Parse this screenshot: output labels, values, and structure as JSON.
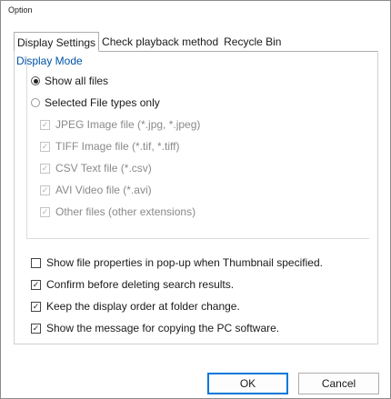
{
  "window": {
    "title": "Option"
  },
  "tabs": [
    {
      "label": "Display Settings",
      "active": true
    },
    {
      "label": "Check playback method",
      "active": false
    },
    {
      "label": "Recycle Bin",
      "active": false
    }
  ],
  "display_mode": {
    "group_label": "Display Mode",
    "show_all_files": {
      "label": "Show all files",
      "selected": true
    },
    "selected_types": {
      "label": "Selected File types only",
      "selected": false
    },
    "file_types": [
      {
        "label": "JPEG Image file (*.jpg, *.jpeg)",
        "checked": true
      },
      {
        "label": "TIFF Image file (*.tif, *.tiff)",
        "checked": true
      },
      {
        "label": "CSV Text file (*.csv)",
        "checked": true
      },
      {
        "label": "AVI Video file (*.avi)",
        "checked": true
      },
      {
        "label": "Other files (other extensions)",
        "checked": true
      }
    ]
  },
  "options": [
    {
      "label": "Show file properties in pop-up when Thumbnail specified.",
      "checked": false
    },
    {
      "label": "Confirm before deleting search results.",
      "checked": true
    },
    {
      "label": "Keep the display order at folder change.",
      "checked": true
    },
    {
      "label": "Show the message for copying the PC software.",
      "checked": true
    }
  ],
  "buttons": {
    "ok": "OK",
    "cancel": "Cancel"
  },
  "glyphs": {
    "check": "✓"
  }
}
